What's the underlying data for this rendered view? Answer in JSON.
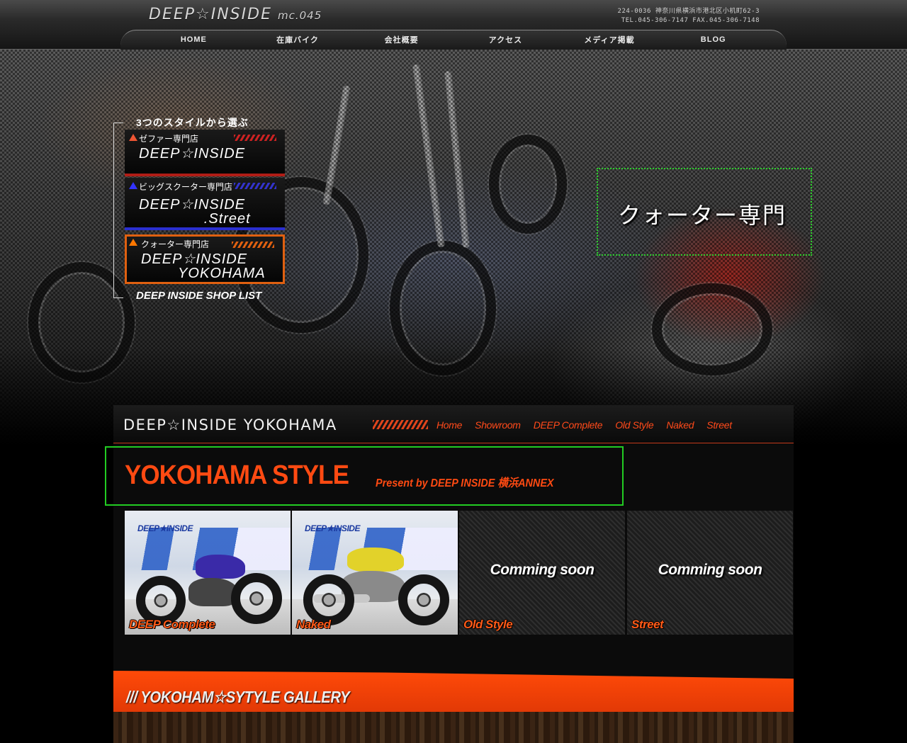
{
  "header": {
    "logo": "DEEP☆INSIDE",
    "logo_sub": "mc.045",
    "address_line1": "224-0036 神奈川県横浜市港北区小机町62-3",
    "address_line2": "TEL.045-306-7147 FAX.045-306-7148"
  },
  "nav": [
    {
      "label": "HOME"
    },
    {
      "label": "在庫バイク"
    },
    {
      "label": "会社概要"
    },
    {
      "label": "アクセス"
    },
    {
      "label": "メディア掲載"
    },
    {
      "label": "BLOG"
    }
  ],
  "style_panel": {
    "heading": "3つのスタイルから選ぶ",
    "cards": [
      {
        "sub": "ゼファー専門店",
        "name": "DEEP☆INSIDE"
      },
      {
        "sub": "ビッグスクーター専門店",
        "name": "DEEP☆INSIDE\n              .Street"
      },
      {
        "sub": "クォーター専門店",
        "name": "DEEP☆INSIDE\n        YOKOHAMA"
      }
    ],
    "shop_list": "DEEP INSIDE SHOP LIST"
  },
  "hero": {
    "tag": "クォーター専門"
  },
  "subnav": {
    "brand": "DEEP☆INSIDE YOKOHAMA",
    "links": [
      "Home",
      "Showroom",
      "DEEP Complete",
      "Old Style",
      "Naked",
      "Street"
    ]
  },
  "style_box": {
    "title": "YOKOHAMA STYLE",
    "subtitle": "Present by DEEP INSIDE 横浜ANNEX"
  },
  "tiles": [
    {
      "caption": "DEEP Complete",
      "overlay": "",
      "logo": "DEEP★INSIDE"
    },
    {
      "caption": "Naked",
      "overlay": "",
      "logo": "DEEP★INSIDE"
    },
    {
      "caption": "Old Style",
      "overlay": "Comming soon"
    },
    {
      "caption": "Street",
      "overlay": "Comming soon"
    }
  ],
  "gallery": {
    "title": "/// YOKOHAM☆SYTYLE GALLERY"
  },
  "colors": {
    "accent": "#ff4a12",
    "hero_tag_border": "#2bd02b",
    "card1_accent": "#b01d16",
    "card2_accent": "#2a2fd0",
    "card3_accent": "#e06010"
  }
}
